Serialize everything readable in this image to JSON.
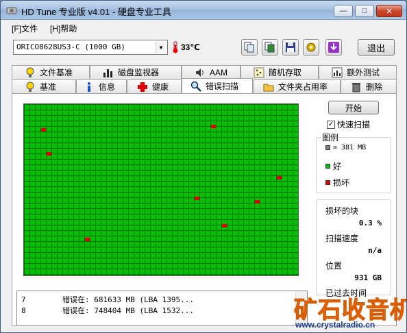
{
  "window": {
    "title": "HD Tune 专业版 v4.01 - 硬盘专业工具",
    "min": "—",
    "max": "□",
    "close": "✕"
  },
  "menu": {
    "file": "[F]文件",
    "help": "[H]帮助"
  },
  "toolbar": {
    "drive": "ORICO8628US3-C (1000 GB)",
    "temperature": "33℃",
    "exit_label": "退出"
  },
  "tabs_top": [
    "文件基准",
    "磁盘监视器",
    "AAM",
    "随机存取",
    "额外测试"
  ],
  "tabs_bottom": [
    "基准",
    "信息",
    "健康",
    "错误扫描",
    "文件夹占用率",
    "删除"
  ],
  "scan": {
    "start_label": "开始",
    "quick_scan_label": "快速扫描",
    "quick_scan_checked": true,
    "legend_title": "图例",
    "legend_block": "= 381 MB",
    "legend_good": "好",
    "legend_bad": "损坏",
    "damaged_label": "损坏的块",
    "damaged_value": "0.3 %",
    "speed_label": "扫描速度",
    "speed_value": "n/a",
    "position_label": "位置",
    "position_value": "931 GB",
    "elapsed_label": "已过去时间",
    "colors": {
      "good": "#00c000",
      "bad": "#e00000",
      "block": "#808080"
    }
  },
  "log": [
    {
      "num": "7",
      "text": "错误在:  681633 MB  (LBA 1395..."
    },
    {
      "num": "8",
      "text": "错误在:  748404 MB  (LBA 1532..."
    }
  ],
  "watermark": {
    "cn": "矿石收音机",
    "url": "www.crystalradio.cn"
  }
}
